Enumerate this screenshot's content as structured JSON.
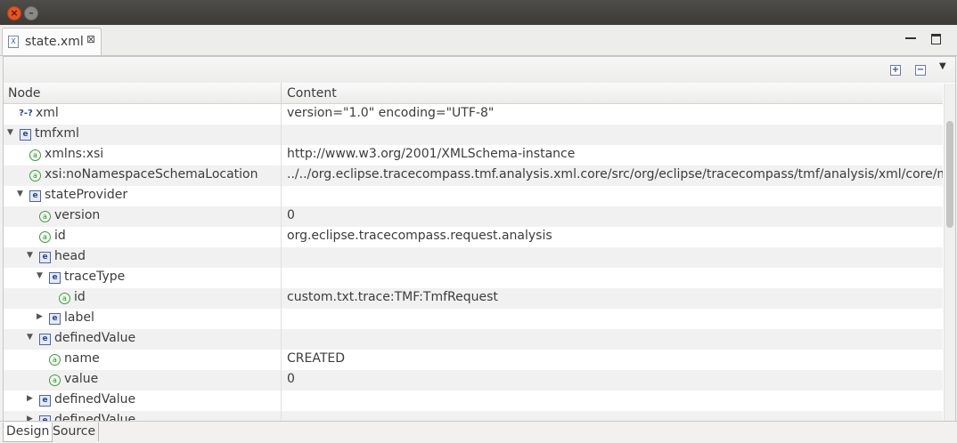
{
  "window": {
    "close_glyph": "×",
    "minimize_glyph": "–"
  },
  "tab": {
    "title": "state.xml",
    "close_glyph": "⊠",
    "file_icon_glyph": "X"
  },
  "toolbar": {
    "expand_glyph": "+",
    "collapse_glyph": "−",
    "menu_glyph": "▼"
  },
  "table": {
    "headers": [
      "Node",
      "Content"
    ],
    "rows": [
      {
        "type": "pi",
        "label": "xml",
        "content": "version=\"1.0\" encoding=\"UTF-8\"",
        "indent": 0,
        "toggle": "",
        "icon_glyph": "?-?"
      },
      {
        "type": "e",
        "label": "tmfxml",
        "content": "",
        "indent": 0,
        "toggle": "▼",
        "icon_glyph": "e"
      },
      {
        "type": "a",
        "label": "xmlns:xsi",
        "content": "http://www.w3.org/2001/XMLSchema-instance",
        "indent": 1,
        "toggle": "",
        "icon_glyph": "a"
      },
      {
        "type": "a",
        "label": "xsi:noNamespaceSchemaLocation",
        "content": "../../org.eclipse.tracecompass.tmf.analysis.xml.core/src/org/eclipse/tracecompass/tmf/analysis/xml/core/m",
        "indent": 1,
        "toggle": "",
        "icon_glyph": "a"
      },
      {
        "type": "e",
        "label": "stateProvider",
        "content": "",
        "indent": 1,
        "toggle": "▼",
        "icon_glyph": "e"
      },
      {
        "type": "a",
        "label": "version",
        "content": "0",
        "indent": 2,
        "toggle": "",
        "icon_glyph": "a"
      },
      {
        "type": "a",
        "label": "id",
        "content": "org.eclipse.tracecompass.request.analysis",
        "indent": 2,
        "toggle": "",
        "icon_glyph": "a"
      },
      {
        "type": "e",
        "label": "head",
        "content": "",
        "indent": 2,
        "toggle": "▼",
        "icon_glyph": "e"
      },
      {
        "type": "e",
        "label": "traceType",
        "content": "",
        "indent": 3,
        "toggle": "▼",
        "icon_glyph": "e"
      },
      {
        "type": "a",
        "label": "id",
        "content": "custom.txt.trace:TMF:TmfRequest",
        "indent": 4,
        "toggle": "",
        "icon_glyph": "a"
      },
      {
        "type": "e",
        "label": "label",
        "content": "",
        "indent": 3,
        "toggle": "▶",
        "icon_glyph": "e"
      },
      {
        "type": "e",
        "label": "definedValue",
        "content": "",
        "indent": 2,
        "toggle": "▼",
        "icon_glyph": "e"
      },
      {
        "type": "a",
        "label": "name",
        "content": "CREATED",
        "indent": 3,
        "toggle": "",
        "icon_glyph": "a"
      },
      {
        "type": "a",
        "label": "value",
        "content": "0",
        "indent": 3,
        "toggle": "",
        "icon_glyph": "a"
      },
      {
        "type": "e",
        "label": "definedValue",
        "content": "",
        "indent": 2,
        "toggle": "▶",
        "icon_glyph": "e"
      },
      {
        "type": "e",
        "label": "definedValue",
        "content": "",
        "indent": 2,
        "toggle": "▶",
        "icon_glyph": "e"
      }
    ]
  },
  "bottom_tabs": [
    {
      "label": "Design",
      "active": true
    },
    {
      "label": "Source",
      "active": false
    }
  ],
  "colors": {
    "titlebar": "#3b3a37",
    "close_button": "#e9541d",
    "element_icon": "#2a47a0",
    "attribute_icon": "#2f8a2f"
  }
}
